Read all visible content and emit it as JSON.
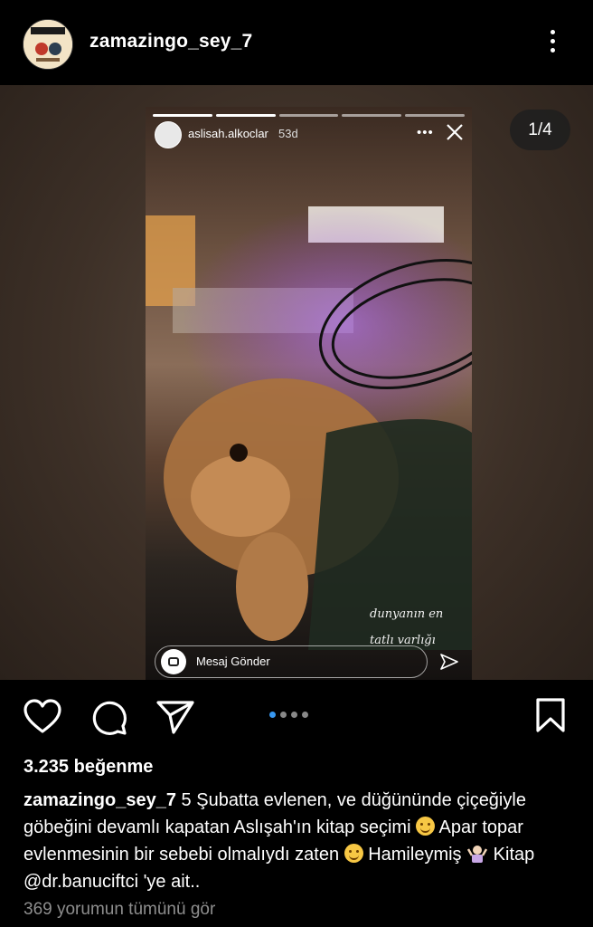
{
  "header": {
    "username": "zamazingo_sey_7",
    "avatar_icon": "profile-avatar-icon",
    "more_icon": "more-vertical-icon"
  },
  "media": {
    "counter": "1/4",
    "story": {
      "username": "aslisah.alkoclar",
      "time": "53d",
      "message_placeholder": "Mesaj Gönder",
      "caption_line1": "dunyanın en",
      "caption_line2": "tatlı varlığı",
      "progress_segments": 5,
      "highlight_color": "#8a2be2"
    }
  },
  "actions": {
    "like_icon": "heart-icon",
    "comment_icon": "comment-icon",
    "share_icon": "send-icon",
    "save_icon": "bookmark-icon",
    "carousel_index": 1,
    "carousel_total": 4
  },
  "post": {
    "likes": "3.235 beğenme",
    "caption_user": "zamazingo_sey_7",
    "caption_part1": "5 Şubatta evlenen, ve düğününde çiçeğiyle göbeğini devamlı kapatan Aslışah'ın kitap seçimi",
    "caption_part2": "Apar topar evlenmesinin bir sebebi olmalıydı zaten",
    "caption_part3": "Hamileymiş",
    "caption_part4": "Kitap @dr.banuciftci 'ye ait..",
    "view_comments": "369 yorumun tümünü gör"
  },
  "colors": {
    "accent": "#3797f0",
    "muted": "#8e8e8e",
    "background": "#000000"
  }
}
